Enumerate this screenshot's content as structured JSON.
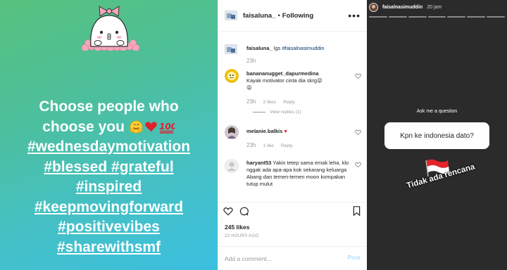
{
  "post_image": {
    "caption_lines": [
      {
        "text": "Choose people who",
        "emojis": []
      },
      {
        "text": "choose you",
        "emojis": [
          "hugging-face",
          "red-heart",
          "hundred-points"
        ]
      },
      {
        "text": "#wednesdaymotivation",
        "hashtag": true
      },
      {
        "text": "#blessed #grateful",
        "hashtag": true
      },
      {
        "text": "#inspired",
        "hashtag": true
      },
      {
        "text": "#keepmovingforward",
        "hashtag": true
      },
      {
        "text": "#positivevibes",
        "hashtag": true
      },
      {
        "text": "#sharewithsmf",
        "hashtag": true
      }
    ],
    "colors": {
      "gradient_start": "#58c27e",
      "gradient_end": "#3bbfe0",
      "mascot_bow": "#f5a6bb"
    }
  },
  "post_panel": {
    "header": {
      "username": "faisaluna_",
      "separator": "•",
      "following": "Following"
    },
    "comments": [
      {
        "username": "faisaluna_",
        "text": "lgs ",
        "tag": "#faisalnasimuddin",
        "time": "23h",
        "likes": "",
        "reply": "",
        "avatar": "photo"
      },
      {
        "username": "banananugget_dapurmedina",
        "text": "Kayak motivator cinta dia skrg😜",
        "emoji_line": "😜",
        "time": "23h",
        "likes": "2 likes",
        "reply": "Reply",
        "view_replies": "View replies (1)",
        "avatar": "yellow"
      },
      {
        "username": "melanie.balkis",
        "text": "♥",
        "time": "23h",
        "likes": "1 like",
        "reply": "Reply",
        "avatar": "photo-girl"
      },
      {
        "username": "haryant53",
        "text": "Yakin tetep sama emak leha, klo nggak ada apa-apa kok sekarang keluarga Abang dan temen-temen moon kompakan tutup mulut",
        "time": "",
        "likes": "",
        "reply": "",
        "avatar": "default"
      }
    ],
    "likes": "245 likes",
    "time_ago": "23 HOURS AGO",
    "add_comment_placeholder": "Add a comment...",
    "post_button": "Post"
  },
  "story": {
    "username": "faisalnasimuddin",
    "time": "20 jam",
    "segments": 7,
    "question_header": "Ask me a question",
    "question": "Kpn ke indonesia dato?",
    "answer": "Tidak ada rencana",
    "colors": {
      "background": "#2b2b2b",
      "flag_red": "#e3242b"
    }
  }
}
